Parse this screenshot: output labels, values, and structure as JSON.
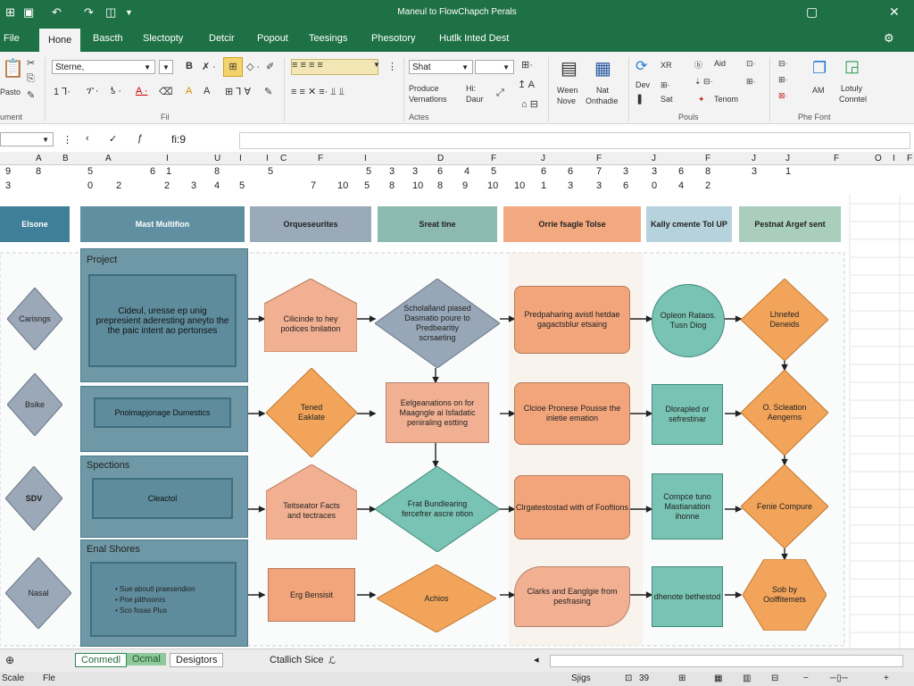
{
  "titlebar": {
    "title": "Maneul to FlowChapch Perals",
    "minimize": "▢",
    "close": "✕"
  },
  "tabs": [
    "File",
    "Hone",
    "Bascth",
    "Slectopty",
    "Detcir",
    "Popout",
    "Teesings",
    "Phesotory",
    "Hutlk Inted Dest"
  ],
  "ribbon": {
    "font_name": "Sterne,",
    "style_name": "Shat",
    "labels": {
      "paste": "Pasto",
      "group_left": "ument",
      "group_file": "Fil",
      "group_actes": "Actes",
      "group_pouls": "Pouls",
      "group_phe_font": "Phe Font",
      "produce": "Produce",
      "vernerations": "Vernatlons",
      "hi": "Hi:",
      "daur": "Daur",
      "ween": "Ween",
      "nove": "Nove",
      "nat": "Nat",
      "onthadie": "Onthadie",
      "xr": "XR",
      "aid": "Aid",
      "dev": "Dev",
      "sat": "Sat",
      "tenom": "Tenom",
      "am": "AM",
      "lolulty": "Lotuly",
      "control": "Conntel"
    }
  },
  "formula_bar": {
    "fx": "fi:9"
  },
  "columns": [
    "A",
    "B",
    "A",
    "I",
    "U",
    "I",
    "I",
    "C",
    "F",
    "I",
    "D",
    "F",
    "J",
    "F",
    "J",
    "F",
    "J",
    "J",
    "F",
    "O",
    "I",
    "F"
  ],
  "digit_rows": {
    "row1": [
      "9",
      "8",
      "5",
      "",
      "6",
      "1",
      "8",
      "5",
      "",
      "5",
      "3",
      "3",
      "6",
      "4",
      "5",
      "6",
      "6",
      "7",
      "3",
      "3",
      "6",
      "8",
      "3",
      "1"
    ],
    "row2": [
      "3",
      "",
      "0",
      "2",
      "2",
      "3",
      "4",
      "5",
      "7",
      "10",
      "5",
      "8",
      "10",
      "8",
      "9",
      "10",
      "10",
      "1",
      "3",
      "3",
      "6",
      "0",
      "4",
      "2"
    ]
  },
  "lanes": [
    "Elsone",
    "Mast Multifion",
    "Orqueseurites",
    "Sreat tine",
    "Orrie fsagle Tolse",
    "Kally cmente Tol UP",
    "Pestnat Argef sent"
  ],
  "left_diamonds": [
    "Carisngs",
    "Bsike",
    "SDV",
    "Nasal"
  ],
  "panels": {
    "p1_title": "Project",
    "p1_body": "Cideul, uresse ep unig prepresient aderesting aneyto the the paic intent ao pertonses",
    "p2_body": "Pnolmapjonage Dumestics",
    "p3_title": "Spections",
    "p3_body": "Cleactol",
    "p4_title": "Enal Shores",
    "p4_items": [
      "Sue aboutl praesendion",
      "Pne pilthoonrs",
      "Sco fosas Plus"
    ]
  },
  "shapes": {
    "c3r1": "Cilicinde to hey podices bnilation",
    "c3r2": "Tened Eaklate",
    "c3r3": "Teitseator Facts and tectraces",
    "c3r4": "Erg Bensisit",
    "c4r1": "Scholalland piased Dasmatio poure to Predbearitiy scrsaeting",
    "c4r2": "Eelgeanations on for Maagngle ai Isfadatic peniraling estting",
    "c4r3": "Frat Bundlearing fercefrer ascre otion",
    "c4r4": "Achios",
    "c5r1": "Predpaharing avistl hetdae gagactsblur etsaing",
    "c5r2": "Clcioe Pronese Pousse the inletie emation",
    "c5r3": "Clrgatestostad with of Fooftions",
    "c5r4": "Clarks and Eanglgie from pesfrasing",
    "c6r1": "Opleon Rataos. Tusn Diog",
    "c6r2": "Dlorapled or sefrestinar",
    "c6r3": "Compce tuno Mastianation ihonne",
    "c6r4": "dhenote bethestod",
    "c7r1": "Lhnefed Deneids",
    "c7r2": "O. Scleation Aengerns",
    "c7r3": "Fenie Compure",
    "c7r4": "Sob by Oolffitemets"
  },
  "sheet_tabs": {
    "tab1": "Conmedl",
    "tab2": "Ocmal",
    "tab3": "Desigtors",
    "name_box": "Ctallich Sice"
  },
  "status": {
    "left1": "Scale",
    "left2": "Fle",
    "mid": "Sjigs",
    "page": "39"
  },
  "colors": {
    "excel_green": "#1e7145",
    "teal": "#6a98a6",
    "grey_diamond": "#97a7b8",
    "salmon": "#f0a882",
    "orange": "#f2a45a",
    "mint": "#78c3b3"
  }
}
